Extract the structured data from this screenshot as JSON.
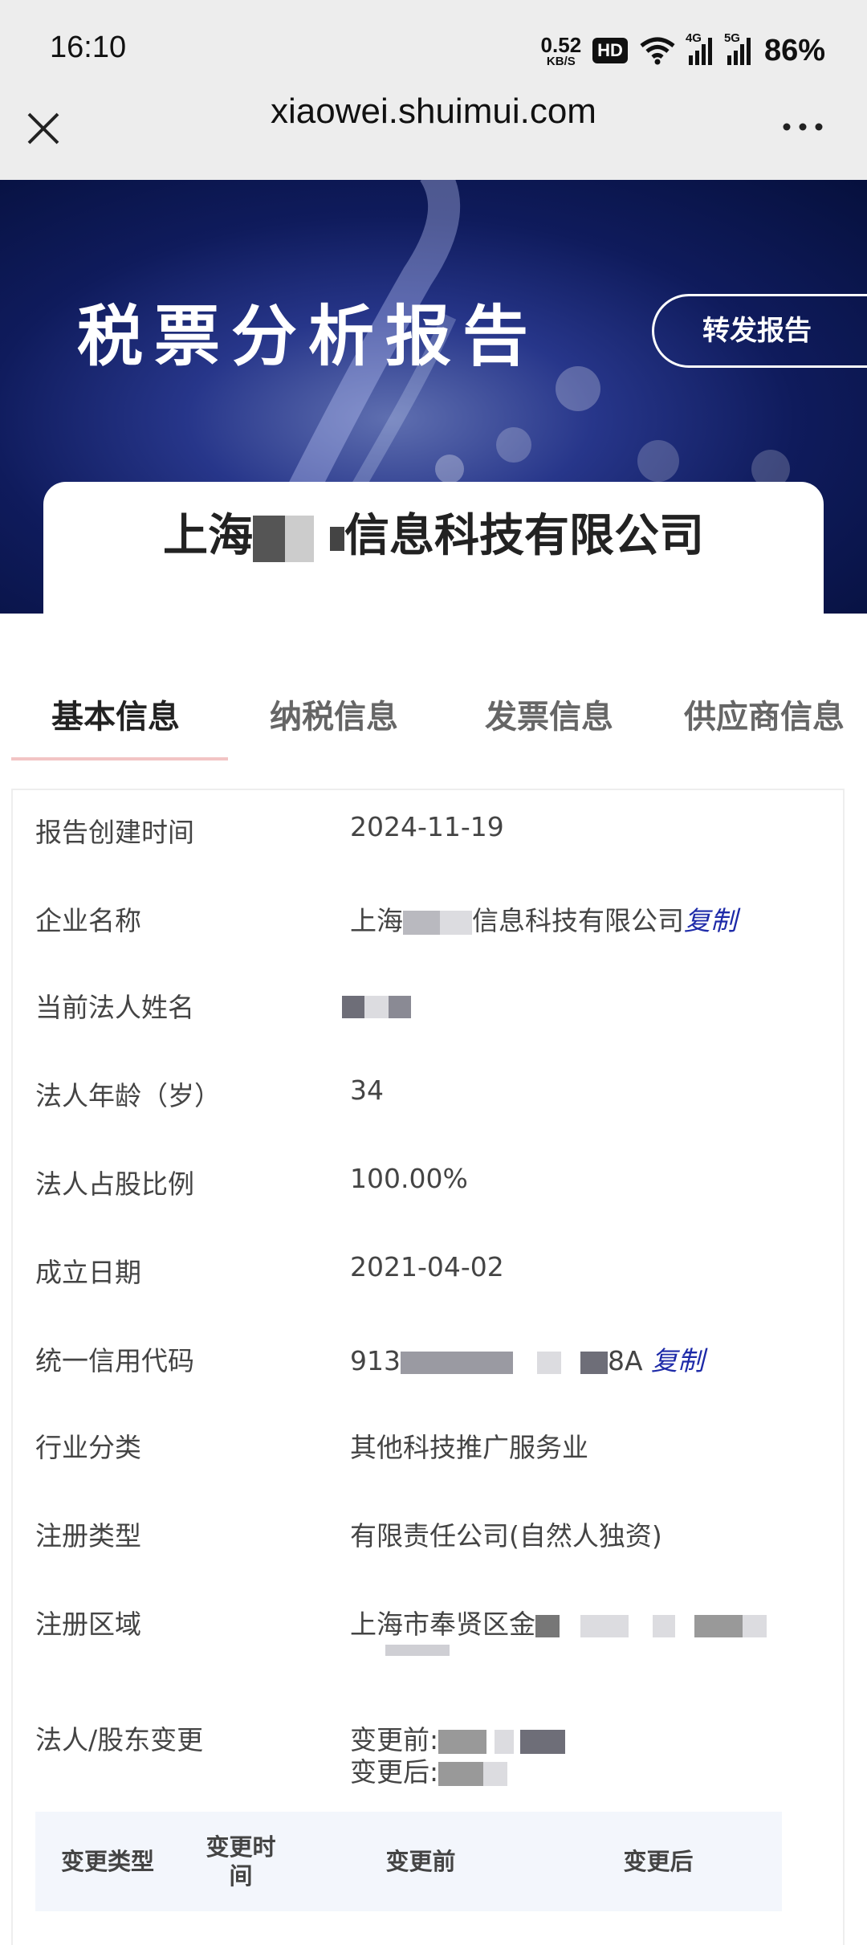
{
  "status_bar": {
    "time": "16:10",
    "net_speed_value": "0.52",
    "net_speed_unit": "KB/S",
    "hd_label": "HD",
    "signal_4g_label": "4G",
    "signal_5g_label": "5G",
    "battery": "86%"
  },
  "browser": {
    "url": "xiaowei.shuimui.com",
    "close_icon": "close-icon",
    "more_icon": "more-icon"
  },
  "banner": {
    "title": "税票分析报告",
    "forward_button": "转发报告",
    "company_name_prefix": "上海",
    "company_name_suffix": "信息科技有限公司"
  },
  "tabs": [
    {
      "label": "基本信息",
      "active": true
    },
    {
      "label": "纳税信息",
      "active": false
    },
    {
      "label": "发票信息",
      "active": false
    },
    {
      "label": "供应商信息",
      "active": false
    }
  ],
  "info": {
    "report_created_label": "报告创建时间",
    "report_created_value": "2024-11-19",
    "company_label": "企业名称",
    "company_value_prefix": "上海",
    "company_value_suffix": "信息科技有限公司",
    "copy_label": "复制",
    "legal_person_label": "当前法人姓名",
    "legal_age_label": "法人年龄（岁）",
    "legal_age_value": "34",
    "share_ratio_label": "法人占股比例",
    "share_ratio_value": "100.00%",
    "founded_label": "成立日期",
    "founded_value": "2021-04-02",
    "credit_code_label": "统一信用代码",
    "credit_code_prefix": "913",
    "credit_code_suffix": "8A",
    "industry_label": "行业分类",
    "industry_value": "其他科技推广服务业",
    "reg_type_label": "注册类型",
    "reg_type_value": "有限责任公司(自然人独资)",
    "reg_area_label": "注册区域",
    "reg_area_value": "上海市奉贤区金",
    "change_label": "法人/股东变更",
    "change_before_label": "变更前:",
    "change_after_label": "变更后:"
  },
  "change_table": {
    "headers": [
      "变更类型",
      "变更时间",
      "变更前",
      "变更后"
    ]
  }
}
